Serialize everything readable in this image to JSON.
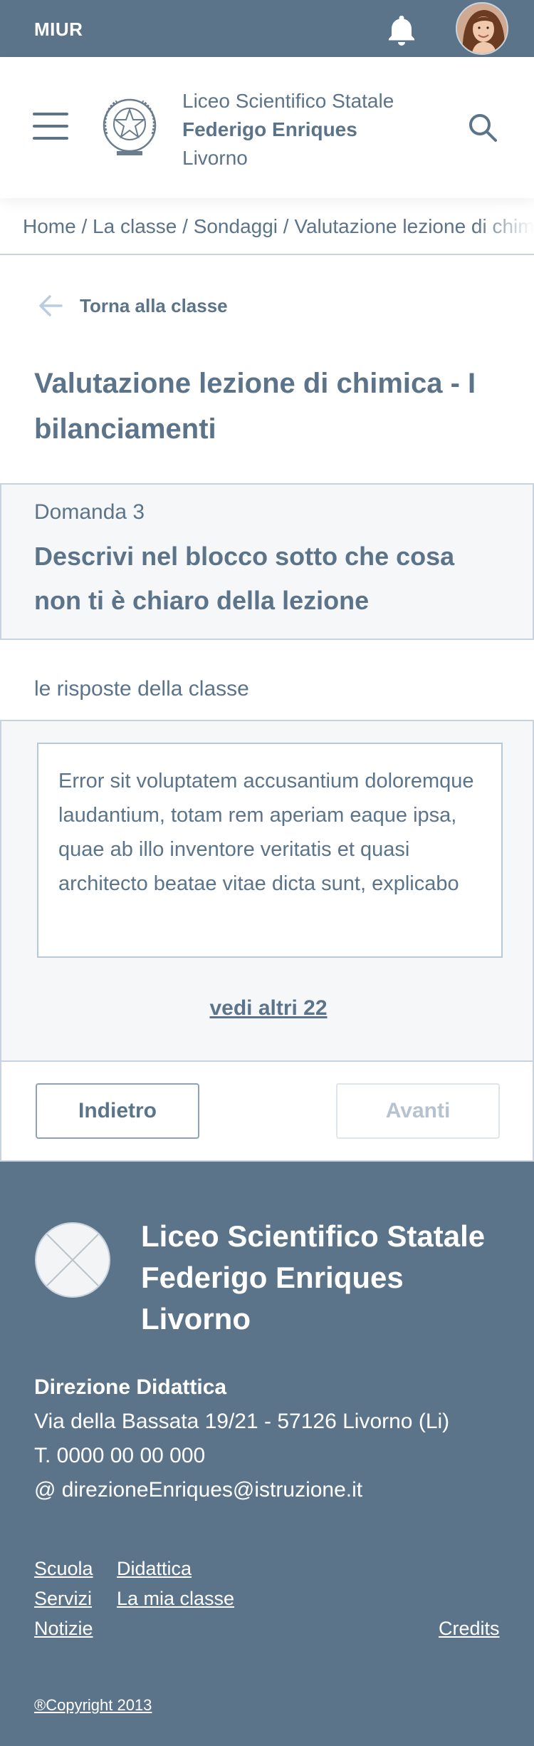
{
  "topbar": {
    "brand": "MIUR",
    "bell_icon": "bell-icon",
    "avatar": "user-avatar"
  },
  "header": {
    "school_line1": "Liceo Scientifico Statale",
    "school_line2": "Federigo Enriques",
    "school_line3": "Livorno",
    "menu_icon": "hamburger-menu-icon",
    "search_icon": "search-icon"
  },
  "breadcrumb": {
    "items": [
      "Home",
      "La classe",
      "Sondaggi",
      "Valutazione lezione di chimica"
    ],
    "separator": " / "
  },
  "back_link": {
    "label": "Torna alla classe",
    "icon": "arrow-left-icon"
  },
  "page_title": "Valutazione lezione di chimica - I bilanciamenti",
  "question": {
    "number": "Domanda 3",
    "text": "Descrivi nel blocco sotto che cosa non ti è chiaro della lezione"
  },
  "answers": {
    "label": "le risposte della classe",
    "items": [
      "Error sit voluptatem accusantium doloremque laudantium, totam rem aperiam eaque ipsa, quae ab illo inventore veritatis et quasi architecto beatae vitae dicta sunt, explicabo"
    ],
    "more_label": "vedi altri 22"
  },
  "nav": {
    "back_label": "Indietro",
    "next_label": "Avanti"
  },
  "footer": {
    "school_name": "Liceo Scientifico Statale Federigo Enriques Livorno",
    "direction_title": "Direzione Didattica",
    "address": "Via della Bassata 19/21 - 57126 Livorno (Li)",
    "phone": "T. 0000 00 00 000",
    "email": "@ direzioneEnriques@istruzione.it",
    "links": {
      "scuola": "Scuola",
      "didattica": "Didattica",
      "servizi": "Servizi",
      "la_mia_classe": "La mia classe",
      "notizie": "Notizie",
      "credits": "Credits"
    },
    "copyright": "®Copyright 2013"
  },
  "colors": {
    "primary": "#5c7489",
    "border": "#c7d3de",
    "panel_bg": "#f6f7f8",
    "disabled": "#b6c3ce"
  }
}
